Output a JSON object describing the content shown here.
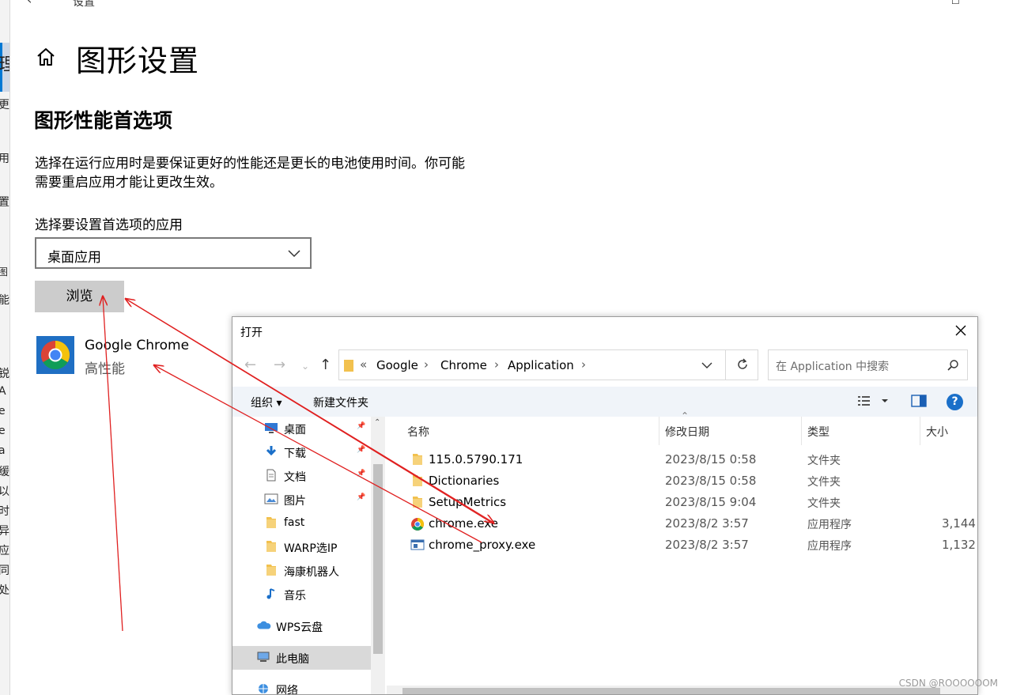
{
  "settings": {
    "window_title": "设置",
    "page_title": "图形设置",
    "section_title": "图形性能首选项",
    "description_line1": "选择在运行应用时是要保证更好的性能还是更长的电池使用时间。你可能",
    "description_line2": "需要重启应用才能让更改生效。",
    "select_label": "选择要设置首选项的应用",
    "app_type_value": "桌面应用",
    "browse_label": "浏览",
    "app_entry": {
      "name": "Google Chrome",
      "preference": "高性能",
      "icon": "chrome-icon"
    },
    "left_strip_fragments": [
      "理",
      "更",
      "用",
      "置",
      "图",
      "能",
      "锐",
      "A",
      "e",
      "e",
      "a",
      "缓",
      "以",
      "时",
      "异",
      "应",
      "同",
      "处"
    ]
  },
  "open_dialog": {
    "title": "打开",
    "breadcrumb": [
      "«",
      "Google",
      "Chrome",
      "Application"
    ],
    "search_placeholder": "在 Application 中搜索",
    "toolbar": {
      "organize": "组织 ▾",
      "new_folder": "新建文件夹",
      "help": "?"
    },
    "nav_items": [
      {
        "label": "桌面",
        "icon": "desktop-icon",
        "pinned": true
      },
      {
        "label": "下载",
        "icon": "download-icon",
        "pinned": true
      },
      {
        "label": "文档",
        "icon": "document-icon",
        "pinned": true
      },
      {
        "label": "图片",
        "icon": "picture-icon",
        "pinned": true
      },
      {
        "label": "fast",
        "icon": "folder-icon",
        "pinned": false
      },
      {
        "label": "WARP选IP",
        "icon": "folder-icon",
        "pinned": false
      },
      {
        "label": "海康机器人",
        "icon": "folder-icon",
        "pinned": false
      },
      {
        "label": "音乐",
        "icon": "music-icon",
        "pinned": false
      },
      {
        "label": "WPS云盘",
        "icon": "cloud-icon",
        "pinned": false
      },
      {
        "label": "此电脑",
        "icon": "computer-icon",
        "pinned": false
      },
      {
        "label": "网络",
        "icon": "network-icon",
        "pinned": false
      }
    ],
    "columns": {
      "name": "名称",
      "modified": "修改日期",
      "type": "类型",
      "size": "大小"
    },
    "files": [
      {
        "name": "115.0.5790.171",
        "modified": "2023/8/15 0:58",
        "type": "文件夹",
        "size": "",
        "icon": "folder-icon"
      },
      {
        "name": "Dictionaries",
        "modified": "2023/8/15 0:58",
        "type": "文件夹",
        "size": "",
        "icon": "folder-icon"
      },
      {
        "name": "SetupMetrics",
        "modified": "2023/8/15 9:04",
        "type": "文件夹",
        "size": "",
        "icon": "folder-icon"
      },
      {
        "name": "chrome.exe",
        "modified": "2023/8/2 3:57",
        "type": "应用程序",
        "size": "3,144",
        "icon": "chrome-icon"
      },
      {
        "name": "chrome_proxy.exe",
        "modified": "2023/8/2 3:57",
        "type": "应用程序",
        "size": "1,132",
        "icon": "exe-icon"
      }
    ]
  },
  "watermark": "CSDN @ROOOOOOM",
  "colors": {
    "accent": "#0078d4",
    "annotation": "#e02020",
    "folder": "#f2c14e"
  }
}
